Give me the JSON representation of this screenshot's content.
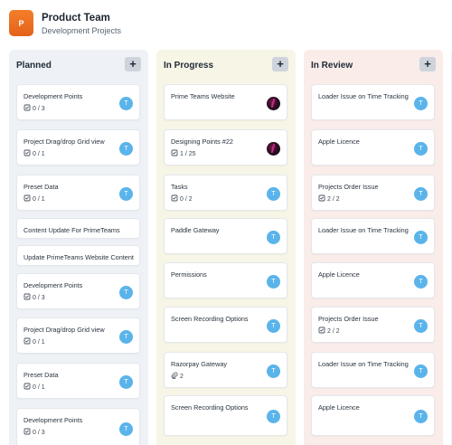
{
  "header": {
    "logo_letter": "P",
    "team_name": "Product Team",
    "subtitle": "Development Projects"
  },
  "columns": [
    {
      "title": "Planned",
      "add_label": "+",
      "cards": [
        {
          "title": "Development Points",
          "meta": "0 / 3",
          "meta_icon": "checklist-icon",
          "avatar": "T"
        },
        {
          "title": "Project Drag/drop Grid view",
          "meta": "0 / 1",
          "meta_icon": "checklist-icon",
          "avatar": "T"
        },
        {
          "title": "Preset Data",
          "meta": "0 / 1",
          "meta_icon": "checklist-icon",
          "avatar": "T"
        },
        {
          "title": "Content Update For PrimeTeams"
        },
        {
          "title": "Update PrimeTeams Website Content"
        },
        {
          "title": "Development Points",
          "meta": "0 / 3",
          "meta_icon": "checklist-icon",
          "avatar": "T"
        },
        {
          "title": "Project Drag/drop Grid view",
          "meta": "0 / 1",
          "meta_icon": "checklist-icon",
          "avatar": "T"
        },
        {
          "title": "Preset Data",
          "meta": "0 / 1",
          "meta_icon": "checklist-icon",
          "avatar": "T"
        },
        {
          "title": "Development Points",
          "meta": "0 / 3",
          "meta_icon": "checklist-icon",
          "avatar": "T"
        }
      ]
    },
    {
      "title": "In Progress",
      "add_label": "+",
      "cards": [
        {
          "title": "Prime Teams Website",
          "avatar_image": true
        },
        {
          "title": "Designing Points #22",
          "meta": "1 / 25",
          "meta_icon": "checklist-icon",
          "avatar_image": true
        },
        {
          "title": "Tasks",
          "meta": "0 / 2",
          "meta_icon": "checklist-icon",
          "avatar": "T"
        },
        {
          "title": "Paddle Gateway",
          "avatar": "T"
        },
        {
          "title": "Permissions",
          "avatar": "T"
        },
        {
          "title": "Screen Recording Options",
          "avatar": "T"
        },
        {
          "title": "Razorpay Gateway",
          "meta": "2",
          "meta_icon": "paperclip-icon",
          "avatar": "T"
        },
        {
          "title": "Screen Recording Options",
          "avatar": "T"
        }
      ]
    },
    {
      "title": "In Review",
      "add_label": "+",
      "cards": [
        {
          "title": "Loader Issue on Time Tracking",
          "avatar": "T"
        },
        {
          "title": "Apple Licence",
          "avatar": "T"
        },
        {
          "title": "Projects Order Issue",
          "meta": "2 / 2",
          "meta_icon": "checklist-icon",
          "avatar": "T"
        },
        {
          "title": "Loader Issue on Time Tracking",
          "avatar": "T"
        },
        {
          "title": "Apple Licence",
          "avatar": "T"
        },
        {
          "title": "Projects Order Issue",
          "meta": "2 / 2",
          "meta_icon": "checklist-icon",
          "avatar": "T"
        },
        {
          "title": "Loader Issue on Time Tracking",
          "avatar": "T"
        },
        {
          "title": "Apple Licence",
          "avatar": "T"
        }
      ]
    }
  ]
}
